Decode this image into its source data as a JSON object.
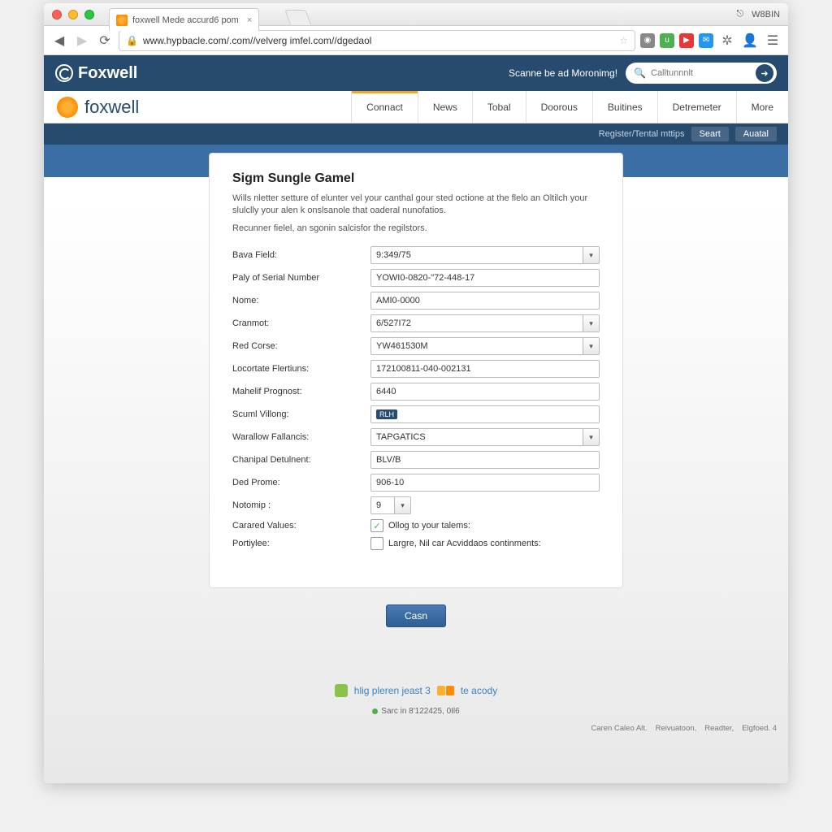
{
  "browser": {
    "tab_title": "foxwell Mede accurd6 pom",
    "url": "www.hypbacle.com/.com//velverg imfel.com//dgedaol",
    "title_right_icon": "⎋",
    "title_right_text": "W8BIN"
  },
  "header": {
    "brand": "Foxwell",
    "tagline": "Scanne be ad Moronimg!",
    "search_placeholder": "Calltunnnlt"
  },
  "nav": {
    "brand": "foxwell",
    "tabs": [
      "Connact",
      "News",
      "Tobal",
      "Doorous",
      "Buitines",
      "Detremeter",
      "More"
    ],
    "active_index": 0
  },
  "subnav": {
    "link": "Register/Tental mttips",
    "btn1": "Seart",
    "btn2": "Auatal"
  },
  "form": {
    "title": "Sigm Sungle Gamel",
    "desc1": "Wills nletter setture of elunter vel your canthal gour sted octione at the flelo an Oltilch your slulclly your alen k onslsanole that oaderal nunofatios.",
    "desc2": "Recunner fielel, an sgonin salcisfor the regilstors.",
    "fields": {
      "bava": {
        "label": "Bava Field:",
        "value": "9:349/75"
      },
      "serial": {
        "label": "Paly of Serial Number",
        "value": "YOWI0-0820-\"72-448-17"
      },
      "nome": {
        "label": "Nome:",
        "value": "AMI0-0000"
      },
      "cranmot": {
        "label": "Cranmot:",
        "value": "6/527I72"
      },
      "red": {
        "label": "Red Corse:",
        "value": "YW461530M"
      },
      "locortate": {
        "label": "Locortate Flertiuns:",
        "value": "172100811-040-002131"
      },
      "mahelif": {
        "label": "Mahelif Prognost:",
        "value": "6440"
      },
      "scuml": {
        "label": "Scuml Villong:",
        "badge": "RLH"
      },
      "warallow": {
        "label": "Warallow Fallancis:",
        "value": "TAPGATICS"
      },
      "chanipal": {
        "label": "Chanipal Detulnent:",
        "value": "BLV/B"
      },
      "ded": {
        "label": "Ded Prome:",
        "value": "906-10"
      },
      "notomip": {
        "label": "Notomip :",
        "value": "9"
      },
      "carared": {
        "label": "Carared Values:",
        "text": "Ollog to your talems:",
        "checked": true
      },
      "portiylee": {
        "label": "Portiylee:",
        "text": "Largre, Nil car Acviddaos continments:",
        "checked": false
      }
    },
    "submit": "Casn"
  },
  "help": {
    "text1": "hlig pleren jeast 3",
    "text2": "te acody"
  },
  "status": "Sarc in 8'122425, 0Il6",
  "footer": [
    "Caren Caleo Alt.",
    "Reivuatoon,",
    "Readter,",
    "Elgfoed. 4"
  ]
}
